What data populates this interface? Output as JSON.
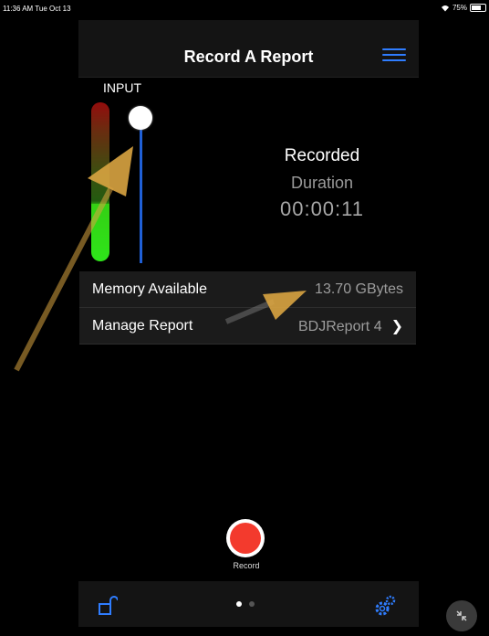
{
  "status": {
    "time": "11:36 AM",
    "date": "Tue Oct 13",
    "battery": "75%",
    "battery_level": 0.75
  },
  "header": {
    "title": "Record A Report"
  },
  "input": {
    "label": "INPUT",
    "slider_level": 0.9
  },
  "recorded": {
    "title": "Recorded",
    "duration_label": "Duration",
    "duration": "00:00:11"
  },
  "list": {
    "memory": {
      "label": "Memory Available",
      "value": "13.70 GBytes"
    },
    "manage": {
      "label": "Manage Report",
      "value": "BDJReport 4"
    }
  },
  "record": {
    "label": "Record"
  },
  "pager": {
    "pages": 2,
    "current": 1
  },
  "colors": {
    "accent": "#2f7dff",
    "record": "#f33a2d",
    "meter_green": "#2ee51a",
    "meter_red": "#c51111",
    "annotation": "#d9a441"
  },
  "icons": [
    "menu-icon",
    "lock-icon",
    "gear-icon",
    "chevron-right-icon",
    "wifi-icon",
    "battery-icon",
    "collapse-icon"
  ]
}
